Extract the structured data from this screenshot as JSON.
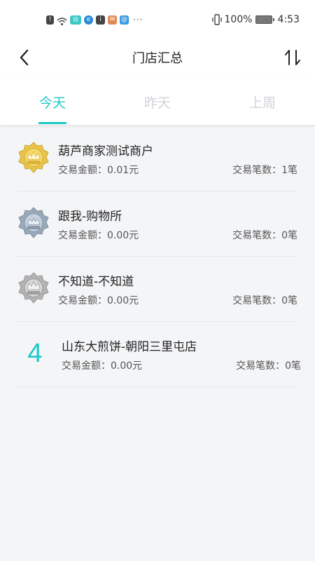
{
  "status_bar": {
    "notification_icons": [
      "alert-icon",
      "wifi-icon",
      "app-icon",
      "browser-icon",
      "info-icon",
      "chat-icon",
      "email-icon"
    ],
    "more": "···",
    "battery_percent": "100%",
    "time": "4:53"
  },
  "nav": {
    "title": "门店汇总"
  },
  "tabs": [
    {
      "label": "今天",
      "active": true
    },
    {
      "label": "昨天",
      "active": false
    },
    {
      "label": "上周",
      "active": false
    }
  ],
  "stores": [
    {
      "rank": "1",
      "medal": "gold",
      "name": "葫芦商家测试商户",
      "amount": "交易金额：0.01元",
      "count": "交易笔数：1笔"
    },
    {
      "rank": "2",
      "medal": "silver",
      "name": "跟我-购物所",
      "amount": "交易金额：0.00元",
      "count": "交易笔数：0笔"
    },
    {
      "rank": "3",
      "medal": "bronze",
      "name": "不知道-不知道",
      "amount": "交易金额：0.00元",
      "count": "交易笔数：0笔"
    },
    {
      "rank": "4",
      "medal": "",
      "name": "山东大煎饼-朝阳三里屯店",
      "amount": "交易金额：0.00元",
      "count": "交易笔数：0笔"
    }
  ],
  "colors": {
    "accent": "#1ec8c8",
    "gold": "#e8c44a",
    "silver": "#9aa9b8",
    "bronze": "#b3b3b3"
  }
}
